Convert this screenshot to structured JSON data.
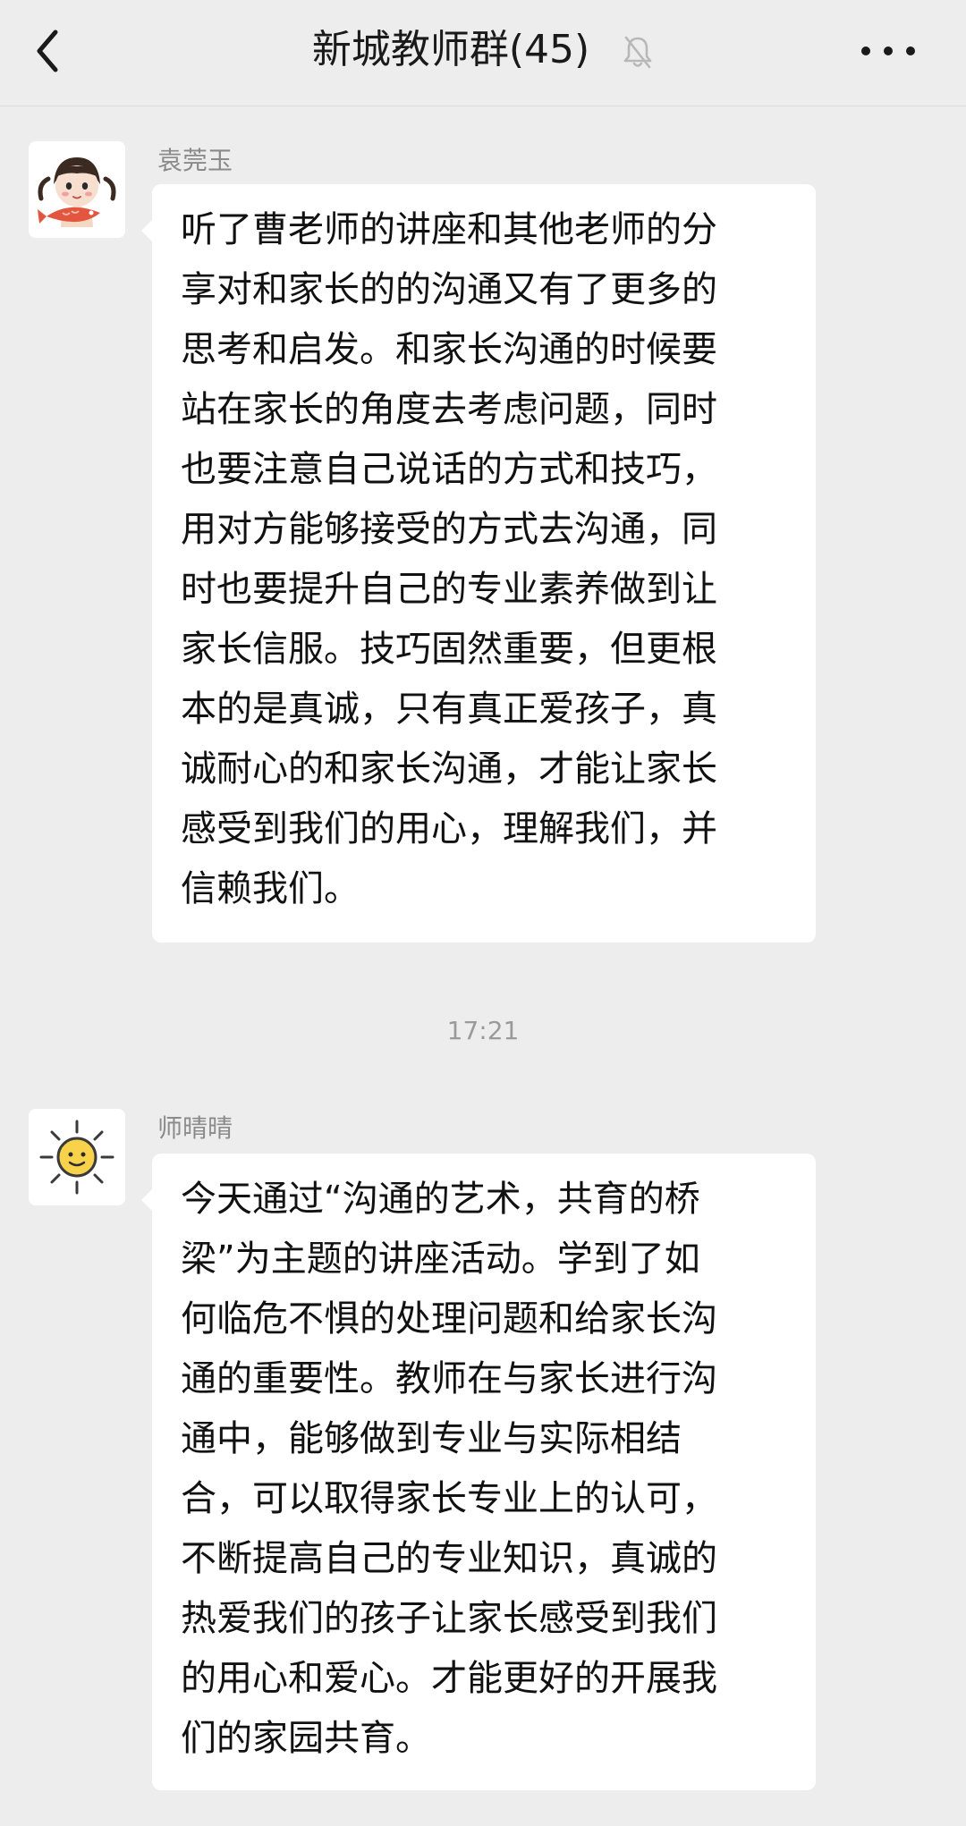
{
  "header": {
    "title": "新城教师群(45)",
    "back_icon": "chevron-left-icon",
    "muted_icon": "bell-off-icon",
    "more_icon": "more-icon"
  },
  "messages": [
    {
      "sender": "袁莞玉",
      "avatar_icon": "girl-with-fish-avatar",
      "text": "听了曹老师的讲座和其他老师的分\n享对和家长的的沟通又有了更多的\n思考和启发。和家长沟通的时候要\n站在家长的角度去考虑问题，同时\n也要注意自己说话的方式和技巧，\n用对方能够接受的方式去沟通，同\n时也要提升自己的专业素养做到让\n家长信服。技巧固然重要，但更根\n本的是真诚，只有真正爱孩子，真\n诚耐心的和家长沟通，才能让家长\n感受到我们的用心，理解我们，并\n信赖我们。"
    },
    {
      "sender": "师晴晴",
      "avatar_icon": "sun-avatar",
      "text": "今天通过“沟通的艺术，共育的桥\n梁”为主题的讲座活动。学到了如\n何临危不惧的处理问题和给家长沟\n通的重要性。教师在与家长进行沟\n通中，能够做到专业与实际相结\n合，可以取得家长专业上的认可，\n不断提高自己的专业知识，真诚的\n热爱我们的孩子让家长感受到我们\n的用心和爱心。才能更好的开展我\n们的家园共育。"
    }
  ],
  "timestamp": "17:21",
  "colors": {
    "background": "#ededed",
    "bubble": "#ffffff",
    "sender_text": "#8a8a8a"
  }
}
